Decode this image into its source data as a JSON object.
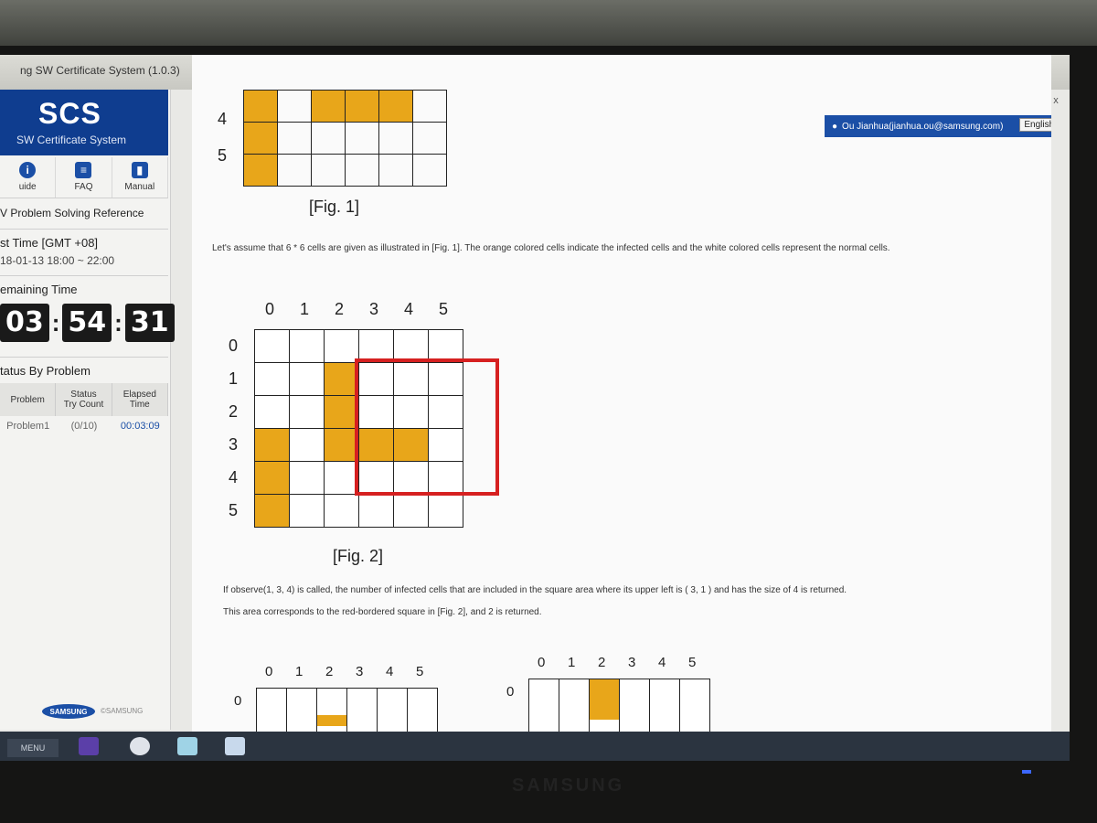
{
  "window": {
    "title": "ng SW Certificate System (1.0.3)",
    "home_icon": "home-icon",
    "help_label": "?",
    "close_label": "x"
  },
  "sidebar": {
    "logo_big": "SCS",
    "logo_small": "SW Certificate System",
    "icons": [
      {
        "label": "uide",
        "icon": "info-icon"
      },
      {
        "label": "FAQ",
        "icon": "faq-icon"
      },
      {
        "label": "Manual",
        "icon": "manual-icon"
      }
    ],
    "reference": "V Problem Solving Reference",
    "test_time_label": "st Time [GMT +08]",
    "test_time_value": "18-01-13 18:00 ~ 22:00",
    "remaining_label": "emaining Time",
    "timer": {
      "h": "03",
      "m": "54",
      "s": "31"
    },
    "status_label": "tatus By Problem",
    "status_headers": [
      "Problem",
      "Status\nTry Count",
      "Elapsed\nTime"
    ],
    "status_row": {
      "problem": "Problem1",
      "tries": "(0/10)",
      "elapsed": "00:03:09"
    },
    "samsung": "SAMSUNG",
    "copyright": "©SAMSUNG"
  },
  "user": {
    "name": "Ou Jianhua(jianhua.ou@samsung.com)",
    "language": "English ▾"
  },
  "fig1": {
    "row_labels": [
      "4",
      "5"
    ],
    "caption": "[Fig. 1]"
  },
  "para1": "Let's assume that 6 * 6 cells are given as illustrated in [Fig. 1]. The orange colored cells indicate the infected cells and the white colored cells represent the normal cells.",
  "fig2": {
    "col_labels": [
      "0",
      "1",
      "2",
      "3",
      "4",
      "5"
    ],
    "row_labels": [
      "0",
      "1",
      "2",
      "3",
      "4",
      "5"
    ],
    "infected": [
      [
        1,
        2
      ],
      [
        2,
        2
      ],
      [
        3,
        0
      ],
      [
        3,
        2
      ],
      [
        3,
        3
      ],
      [
        3,
        4
      ],
      [
        4,
        0
      ],
      [
        5,
        0
      ]
    ],
    "highlight": {
      "row": 1,
      "col": 3,
      "size": 4
    },
    "caption": "[Fig. 2]"
  },
  "para2": "If observe(1, 3, 4) is called, the number of infected cells that are included in the square area where its upper left is ( 3, 1 ) and has the size of 4 is returned.",
  "para3": "This area corresponds to the red-bordered square in [Fig. 2], and 2 is returned.",
  "fig3a": {
    "col_labels": [
      "0",
      "1",
      "2",
      "3",
      "4",
      "5"
    ],
    "row_label": "0"
  },
  "fig3b": {
    "col_labels": [
      "0",
      "1",
      "2",
      "3",
      "4",
      "5"
    ],
    "row_label": "0"
  },
  "taskbar": {
    "menu": "MENU"
  },
  "monitor_brand": "SAMSUNG"
}
